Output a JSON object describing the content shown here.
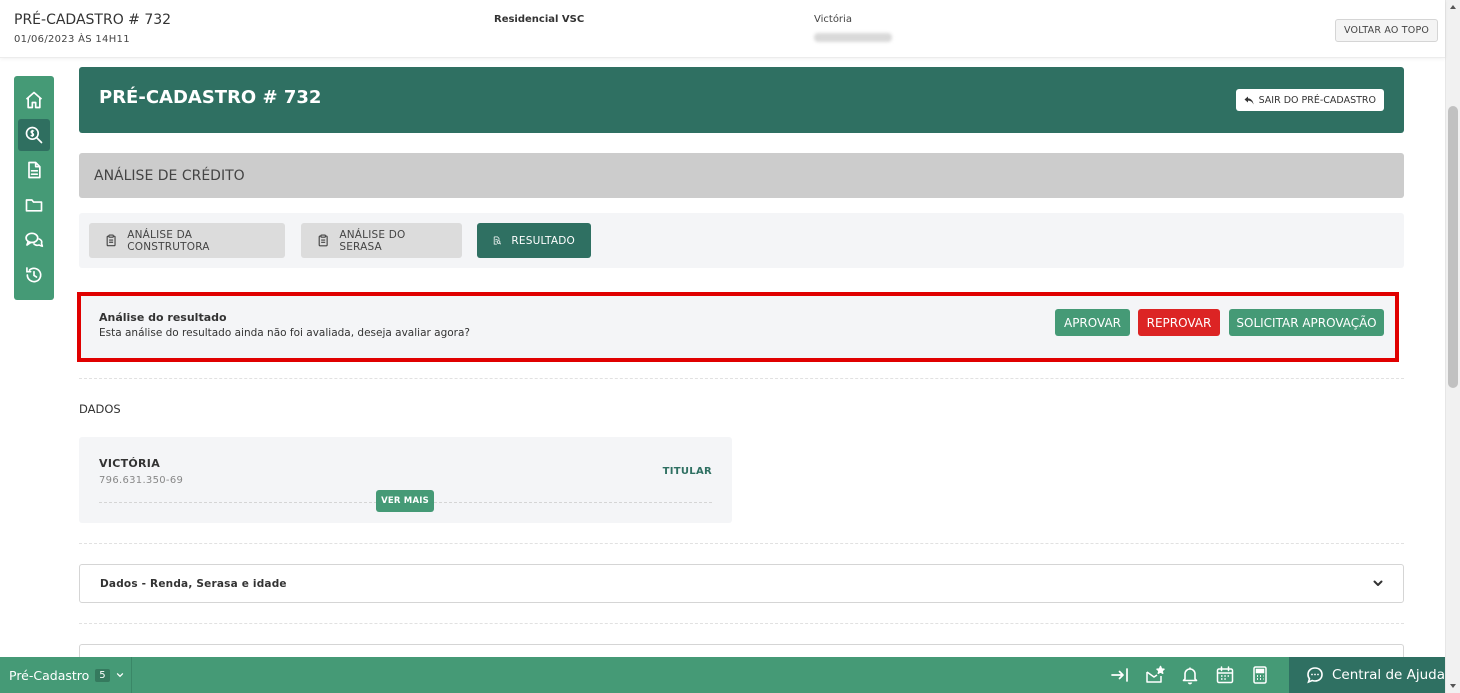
{
  "header": {
    "title": "PRÉ-CADASTRO # 732",
    "datetime": "01/06/2023 ÀS 14H11",
    "project": "Residencial VSC",
    "client_name": "Victória",
    "back_to_top": "VOLTAR AO TOPO"
  },
  "sidebar": {
    "items": [
      {
        "name": "home",
        "icon": "home-icon"
      },
      {
        "name": "credit-analysis",
        "icon": "money-search-icon",
        "active": true
      },
      {
        "name": "documents",
        "icon": "document-icon"
      },
      {
        "name": "folders",
        "icon": "folder-icon"
      },
      {
        "name": "chat",
        "icon": "chat-icon"
      },
      {
        "name": "history",
        "icon": "history-icon"
      }
    ]
  },
  "page": {
    "title": "PRÉ-CADASTRO # 732",
    "exit_label": "SAIR DO PRÉ-CADASTRO"
  },
  "section": {
    "title": "ANÁLISE DE CRÉDITO"
  },
  "tabs": [
    {
      "label": "ANÁLISE DA CONSTRUTORA",
      "active": false
    },
    {
      "label": "ANÁLISE DO SERASA",
      "active": false
    },
    {
      "label": "RESULTADO",
      "active": true
    }
  ],
  "alert": {
    "title": "Análise do resultado",
    "message": "Esta análise do resultado ainda não foi avaliada, deseja avaliar agora?",
    "approve_label": "APROVAR",
    "reject_label": "REPROVAR",
    "request_label": "SOLICITAR APROVAÇÃO"
  },
  "dados": {
    "label": "DADOS",
    "person": {
      "name": "VICTÓRIA",
      "cpf": "796.631.350-69",
      "role": "TITULAR",
      "more_label": "VER MAIS"
    }
  },
  "accordion": {
    "title": "Dados - Renda, Serasa e idade"
  },
  "bottombar": {
    "module": "Pré-Cadastro",
    "badge": "5",
    "help_label": "Central de Ajuda",
    "icons": [
      "collapse-icon",
      "mail-star-icon",
      "bell-icon",
      "calendar-icon",
      "calculator-icon"
    ]
  },
  "colors": {
    "primary_dark": "#2f7062",
    "primary": "#459a76",
    "danger": "#dc2424",
    "alert_border": "#e00000"
  }
}
